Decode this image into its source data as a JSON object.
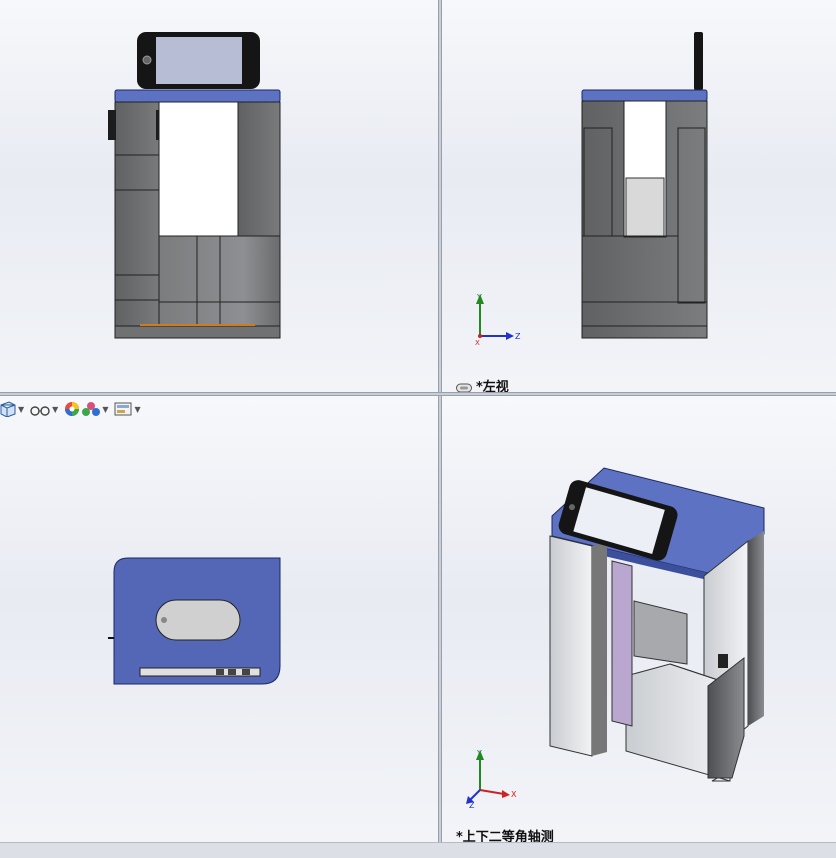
{
  "viewports": {
    "top_left": {
      "label": ""
    },
    "top_right": {
      "label": "*左视",
      "triad": {
        "y": "Y",
        "x": "X",
        "z": "Z"
      }
    },
    "bottom_left": {
      "label": ""
    },
    "bottom_right": {
      "label": "*上下二等角轴测",
      "triad": {
        "y": "Y",
        "x": "X",
        "z": "Z"
      }
    }
  },
  "heads_up_toolbar": {
    "items": [
      {
        "icon": "view-orientation-icon"
      },
      {
        "icon": "hide-show-items-icon"
      },
      {
        "icon": "edit-appearance-icon"
      },
      {
        "icon": "apply-scene-icon"
      },
      {
        "icon": "view-settings-icon"
      }
    ]
  },
  "colors": {
    "top_plate": "#5e72c4",
    "body_gray": "#6d6f71",
    "viewport_bg": "#eef0f5",
    "triad_x": "#cc2222",
    "triad_y": "#228822",
    "triad_z": "#2233cc"
  }
}
